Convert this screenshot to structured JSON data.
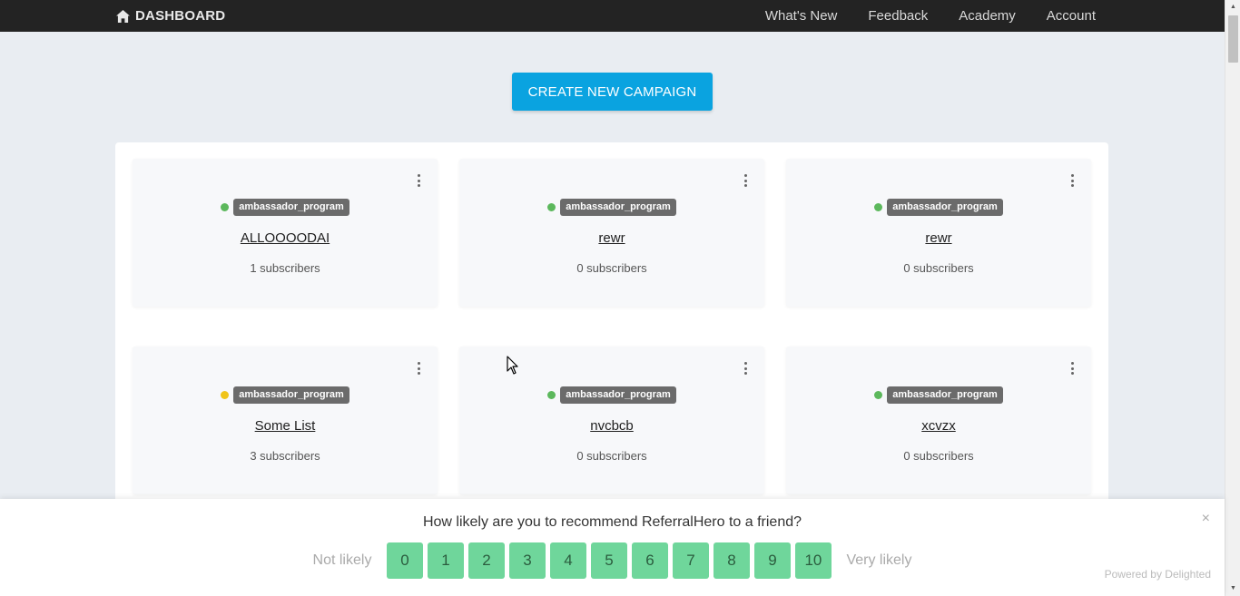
{
  "nav": {
    "brand": "DASHBOARD",
    "links": [
      "What's New",
      "Feedback",
      "Academy",
      "Account"
    ]
  },
  "create_button": "CREATE NEW CAMPAIGN",
  "campaigns": [
    {
      "status_color": "#5cb85c",
      "tag": "ambassador_program",
      "name": "ALLOOOODAI",
      "subscribers": "1 subscribers"
    },
    {
      "status_color": "#5cb85c",
      "tag": "ambassador_program",
      "name": "rewr",
      "subscribers": "0 subscribers"
    },
    {
      "status_color": "#5cb85c",
      "tag": "ambassador_program",
      "name": "rewr",
      "subscribers": "0 subscribers"
    },
    {
      "status_color": "#f0c419",
      "tag": "ambassador_program",
      "name": "Some List",
      "subscribers": "3 subscribers"
    },
    {
      "status_color": "#5cb85c",
      "tag": "ambassador_program",
      "name": "nvcbcb",
      "subscribers": "0 subscribers"
    },
    {
      "status_color": "#5cb85c",
      "tag": "ambassador_program",
      "name": "xcvzx",
      "subscribers": "0 subscribers"
    }
  ],
  "survey": {
    "question": "How likely are you to recommend ReferralHero to a friend?",
    "low_label": "Not likely",
    "high_label": "Very likely",
    "scores": [
      "0",
      "1",
      "2",
      "3",
      "4",
      "5",
      "6",
      "7",
      "8",
      "9",
      "10"
    ],
    "close": "×",
    "powered_by": "Powered by Delighted"
  },
  "colors": {
    "nav_bg": "#232323",
    "accent": "#0aa3e0",
    "score_bg": "#6fd69b"
  }
}
